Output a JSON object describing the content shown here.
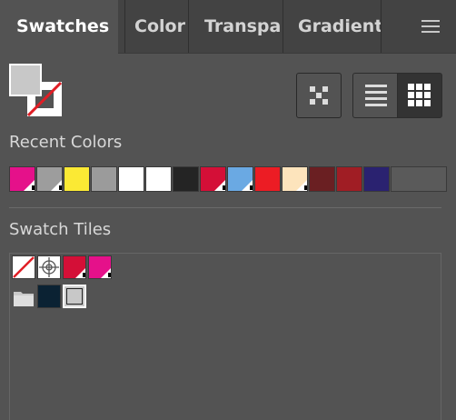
{
  "tabs": [
    {
      "label": "Swatches",
      "active": true
    },
    {
      "label": "Color",
      "active": false
    },
    {
      "label": "Transpa",
      "active": false
    },
    {
      "label": "Gradient",
      "active": false
    }
  ],
  "fill_color": "#c8c8c8",
  "stroke_color": "none",
  "sections": {
    "recent_title": "Recent Colors",
    "tiles_title": "Swatch Tiles"
  },
  "recent_colors": [
    {
      "color": "#e5118a",
      "global": true
    },
    {
      "color": "#9d9d9d",
      "global": true
    },
    {
      "color": "#fbe934",
      "global": false
    },
    {
      "color": "#9b9b9b",
      "global": false
    },
    {
      "color": "#ffffff",
      "global": false
    },
    {
      "color": "#ffffff",
      "global": false
    },
    {
      "color": "#242424",
      "global": false
    },
    {
      "color": "#d40f37",
      "global": true
    },
    {
      "color": "#6aa9e3",
      "global": true
    },
    {
      "color": "#ec1c24",
      "global": false
    },
    {
      "color": "#fde4bc",
      "global": true
    },
    {
      "color": "#6a1f22",
      "global": false
    },
    {
      "color": "#a01d24",
      "global": false
    },
    {
      "color": "#2a2270",
      "global": false
    }
  ],
  "swatch_tiles": [
    {
      "kind": "none"
    },
    {
      "kind": "registration"
    },
    {
      "kind": "color",
      "color": "#d40f37",
      "global": true
    },
    {
      "kind": "color",
      "color": "#e5118a",
      "global": true
    },
    {
      "kind": "folder"
    },
    {
      "kind": "color",
      "color": "#0b2233",
      "global": false
    },
    {
      "kind": "color",
      "color": "#c8c8c8",
      "global": false,
      "selected": true
    }
  ],
  "icons": {
    "menu": "hamburger-menu-icon",
    "kind": "show-swatch-kinds-icon",
    "list": "list-view-icon",
    "grid": "grid-view-icon"
  }
}
